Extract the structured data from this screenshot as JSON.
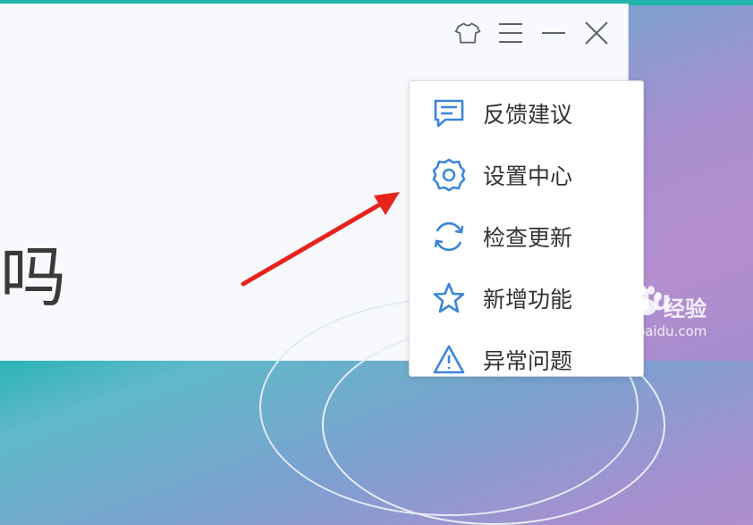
{
  "titlebar": {
    "icons": [
      "skin-tshirt-icon",
      "menu-hamburger-icon",
      "minimize-icon",
      "close-icon"
    ]
  },
  "main": {
    "glyph": "吗"
  },
  "dropdown_menu": {
    "items": [
      {
        "label": "反馈建议",
        "icon": "feedback-chat-icon"
      },
      {
        "label": "设置中心",
        "icon": "settings-gear-icon"
      },
      {
        "label": "检查更新",
        "icon": "check-update-refresh-icon"
      },
      {
        "label": "新增功能",
        "icon": "new-feature-star-icon"
      },
      {
        "label": "异常问题",
        "icon": "exception-warning-icon"
      }
    ]
  },
  "annotation": {
    "arrow_color": "#e8231c"
  },
  "watermark": {
    "brand": "Baidu",
    "cn": "经验",
    "url": "jingyan.baidu.com"
  },
  "colors": {
    "accent": "#3a86d9",
    "arrow": "#e8231c"
  }
}
